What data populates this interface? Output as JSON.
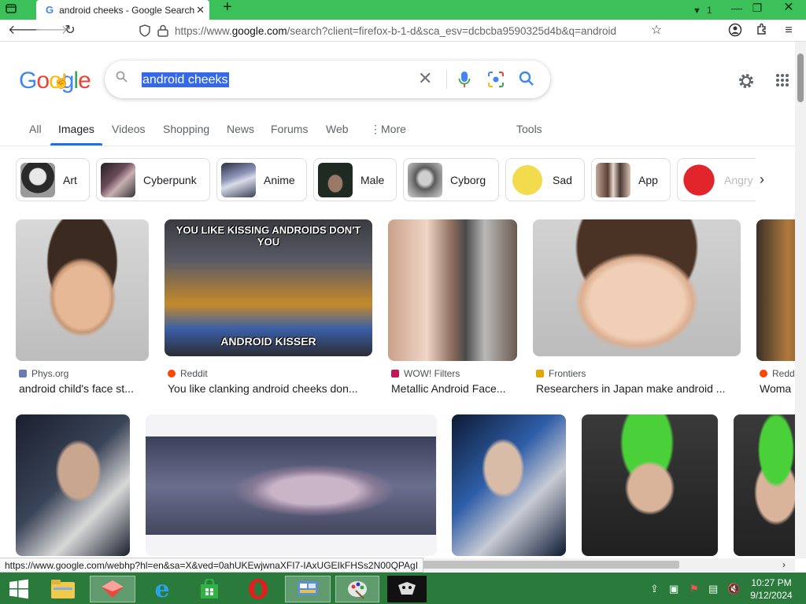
{
  "browser": {
    "tab_title": "android cheeks - Google Search",
    "tab_count": "1",
    "url_prefix": "https://www.",
    "url_domain": "google.com",
    "url_rest": "/search?client=firefox-b-1-d&sca_esv=dcbcba9590325d4b&q=android"
  },
  "google": {
    "logo": [
      "G",
      "o",
      "o",
      "g",
      "l",
      "e"
    ],
    "query": "android cheeks",
    "tabs": [
      "All",
      "Images",
      "Videos",
      "Shopping",
      "News",
      "Forums",
      "Web",
      "More",
      "Tools"
    ],
    "active_tab": "Images"
  },
  "chips": [
    "Art",
    "Cyberpunk",
    "Anime",
    "Male",
    "Cyborg",
    "Sad",
    "App",
    "Angry"
  ],
  "results_row1": [
    {
      "source": "Phys.org",
      "title": "android child's face st..."
    },
    {
      "source": "Reddit",
      "title": "You like clanking android cheeks don...",
      "meme_top": "YOU LIKE KISSING ANDROIDS DON'T YOU",
      "meme_bottom": "ANDROID KISSER"
    },
    {
      "source": "WOW! Filters",
      "title": "Metallic Android Face..."
    },
    {
      "source": "Frontiers",
      "title": "Researchers in Japan make android ..."
    },
    {
      "source": "Redd",
      "title": "Woma"
    }
  ],
  "status_url": "https://www.google.com/webhp?hl=en&sa=X&ved=0ahUKEwjwnaXFI7-IAxUGEIkFHSs2N00QPAgI",
  "clock": {
    "time": "10:27 PM",
    "date": "9/12/2024"
  },
  "colors": {
    "accent": "#1a73e8",
    "titlebar": "#3cc15a",
    "taskbar": "#2a7a3c"
  }
}
